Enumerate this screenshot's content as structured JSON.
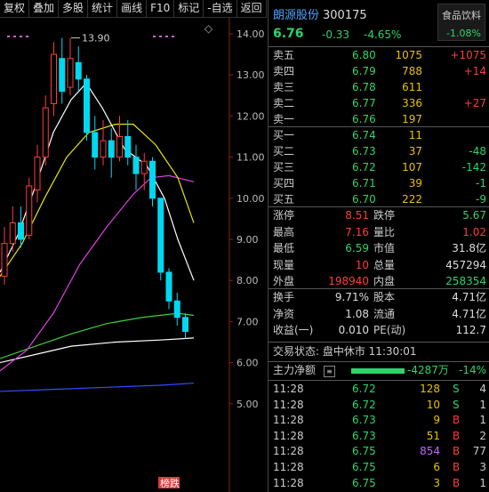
{
  "toolbar": {
    "items": [
      "复权",
      "叠加",
      "多股",
      "统计",
      "画线",
      "F10",
      "标记",
      "-自选",
      "返回"
    ]
  },
  "chart": {
    "axis_labels": [
      "14.00",
      "13.00",
      "12.00",
      "11.00",
      "10.00",
      "9.00",
      "8.00",
      "7.00",
      "6.00",
      "5.00"
    ],
    "high_label": "13.90",
    "bottom_tag": "榜跌",
    "settings_icon": "diamond-icon",
    "candles": [
      {
        "o": 8.1,
        "c": 8.9,
        "h": 9.3,
        "l": 7.9
      },
      {
        "o": 8.9,
        "c": 9.4,
        "h": 9.8,
        "l": 8.7
      },
      {
        "o": 9.4,
        "c": 9.0,
        "h": 9.8,
        "l": 8.8
      },
      {
        "o": 9.1,
        "c": 10.3,
        "h": 10.5,
        "l": 9.0
      },
      {
        "o": 10.2,
        "c": 11.0,
        "h": 11.3,
        "l": 9.9
      },
      {
        "o": 11.0,
        "c": 12.2,
        "h": 12.5,
        "l": 10.8
      },
      {
        "o": 12.3,
        "c": 13.5,
        "h": 13.8,
        "l": 12.0
      },
      {
        "o": 13.4,
        "c": 12.6,
        "h": 13.9,
        "l": 12.3
      },
      {
        "o": 12.7,
        "c": 13.4,
        "h": 13.9,
        "l": 12.5
      },
      {
        "o": 13.3,
        "c": 12.9,
        "h": 13.7,
        "l": 12.6
      },
      {
        "o": 12.9,
        "c": 11.6,
        "h": 13.0,
        "l": 11.4
      },
      {
        "o": 11.6,
        "c": 11.0,
        "h": 12.0,
        "l": 10.7
      },
      {
        "o": 11.0,
        "c": 11.4,
        "h": 11.9,
        "l": 10.8
      },
      {
        "o": 11.4,
        "c": 11.0,
        "h": 11.7,
        "l": 10.5
      },
      {
        "o": 11.0,
        "c": 11.5,
        "h": 12.0,
        "l": 10.9
      },
      {
        "o": 11.5,
        "c": 11.0,
        "h": 11.9,
        "l": 10.8
      },
      {
        "o": 11.0,
        "c": 10.6,
        "h": 11.3,
        "l": 10.2
      },
      {
        "o": 10.6,
        "c": 10.9,
        "h": 11.1,
        "l": 10.2
      },
      {
        "o": 10.9,
        "c": 10.0,
        "h": 11.0,
        "l": 9.8
      },
      {
        "o": 10.0,
        "c": 8.2,
        "h": 10.0,
        "l": 8.0
      },
      {
        "o": 8.2,
        "c": 7.5,
        "h": 8.3,
        "l": 7.3
      },
      {
        "o": 7.5,
        "c": 7.1,
        "h": 7.7,
        "l": 6.9
      },
      {
        "o": 7.1,
        "c": 6.76,
        "h": 7.2,
        "l": 6.59
      }
    ]
  },
  "quote": {
    "name": "朗源股份",
    "code": "300175",
    "price": "6.76",
    "change": "-0.33",
    "change_pct": "-4.65%",
    "sector_name": "食品饮料",
    "sector_pct": "-1.08%",
    "asks": [
      {
        "label": "卖五",
        "price": "6.80",
        "vol": "1075",
        "delta": "+1075"
      },
      {
        "label": "卖四",
        "price": "6.79",
        "vol": "788",
        "delta": "+14"
      },
      {
        "label": "卖三",
        "price": "6.78",
        "vol": "611",
        "delta": ""
      },
      {
        "label": "卖二",
        "price": "6.77",
        "vol": "336",
        "delta": "+27"
      },
      {
        "label": "卖一",
        "price": "6.76",
        "vol": "197",
        "delta": ""
      }
    ],
    "bids": [
      {
        "label": "买一",
        "price": "6.74",
        "vol": "11",
        "delta": ""
      },
      {
        "label": "买二",
        "price": "6.73",
        "vol": "37",
        "delta": "-48"
      },
      {
        "label": "买三",
        "price": "6.72",
        "vol": "107",
        "delta": "-142"
      },
      {
        "label": "买四",
        "price": "6.71",
        "vol": "39",
        "delta": "-1"
      },
      {
        "label": "买五",
        "price": "6.70",
        "vol": "222",
        "delta": "-9"
      }
    ],
    "stats": [
      {
        "l1": "涨停",
        "v1": "8.51",
        "l2": "跌停",
        "v2": "5.67"
      },
      {
        "l1": "最高",
        "v1": "7.16",
        "l2": "量比",
        "v2": "1.02"
      },
      {
        "l1": "最低",
        "v1": "6.59",
        "l2": "市值",
        "v2": "31.8亿"
      },
      {
        "l1": "现量",
        "v1": "10",
        "l2": "总量",
        "v2": "457294"
      },
      {
        "l1": "外盘",
        "v1": "198940",
        "l2": "内盘",
        "v2": "258354"
      }
    ],
    "stats2": [
      {
        "l1": "换手",
        "v1": "9.71%",
        "l2": "股本",
        "v2": "4.71亿"
      },
      {
        "l1": "净资",
        "v1": "1.08",
        "l2": "流通",
        "v2": "4.71亿"
      },
      {
        "l1": "收益(一)",
        "v1": "0.010",
        "l2": "PE(动)",
        "v2": "112.7"
      }
    ],
    "status": "交易状态: 盘中休市 11:30:01",
    "netflow_label": "主力净额",
    "netflow_value": "-4287万",
    "netflow_pct": "-14%",
    "ticks": [
      {
        "t": "11:28",
        "p": "6.72",
        "v": "128",
        "bs": "S",
        "n": "4"
      },
      {
        "t": "11:28",
        "p": "6.72",
        "v": "10",
        "bs": "S",
        "n": "1"
      },
      {
        "t": "11:28",
        "p": "6.73",
        "v": "9",
        "bs": "B",
        "n": "1"
      },
      {
        "t": "11:28",
        "p": "6.73",
        "v": "51",
        "bs": "B",
        "n": "2"
      },
      {
        "t": "11:28",
        "p": "6.75",
        "v": "854",
        "bs": "B",
        "n": "77"
      },
      {
        "t": "11:28",
        "p": "6.75",
        "v": "6",
        "bs": "B",
        "n": "3"
      },
      {
        "t": "11:28",
        "p": "6.75",
        "v": "3",
        "bs": "B",
        "n": "1"
      }
    ]
  }
}
